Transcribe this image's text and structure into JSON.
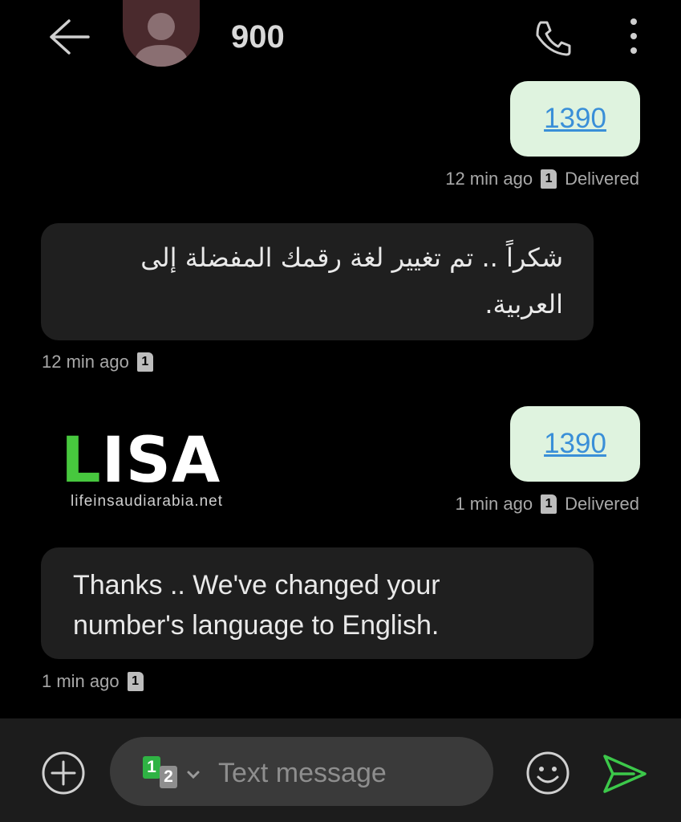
{
  "header": {
    "contact_name": "900"
  },
  "messages": [
    {
      "direction": "out",
      "text": "1390",
      "time": "12 min ago",
      "sim": "1",
      "status": "Delivered"
    },
    {
      "direction": "in",
      "lines": [
        "شكراً .. تم تغيير لغة رقمك المفضلة إلى",
        "العربية."
      ],
      "time": "12 min ago",
      "sim": "1"
    },
    {
      "direction": "out",
      "text": "1390",
      "time": "1 min ago",
      "sim": "1",
      "status": "Delivered"
    },
    {
      "direction": "in",
      "lines": [
        "Thanks .. We've changed your",
        "number's language to English."
      ],
      "time": "1 min ago",
      "sim": "1"
    }
  ],
  "watermark": {
    "first_letter": "L",
    "rest": "ISA",
    "url": "lifeinsaudiarabia.net"
  },
  "composer": {
    "placeholder": "Text message",
    "sim_primary": "1",
    "sim_secondary": "2"
  },
  "icons": {
    "back": "arrow-left-icon",
    "avatar": "person-icon",
    "call": "phone-icon",
    "more": "more-vertical-icon",
    "add": "plus-circle-icon",
    "emoji": "smiley-icon",
    "send": "send-icon",
    "sim_chevron": "chevron-down-icon"
  },
  "colors": {
    "background": "#000000",
    "outgoing_bubble": "#dff3df",
    "incoming_bubble": "#1f1f1f",
    "link": "#3a8fd8",
    "send_accent": "#3cc84a",
    "sim1_badge": "#2fb344",
    "logo_green": "#47c83e"
  }
}
